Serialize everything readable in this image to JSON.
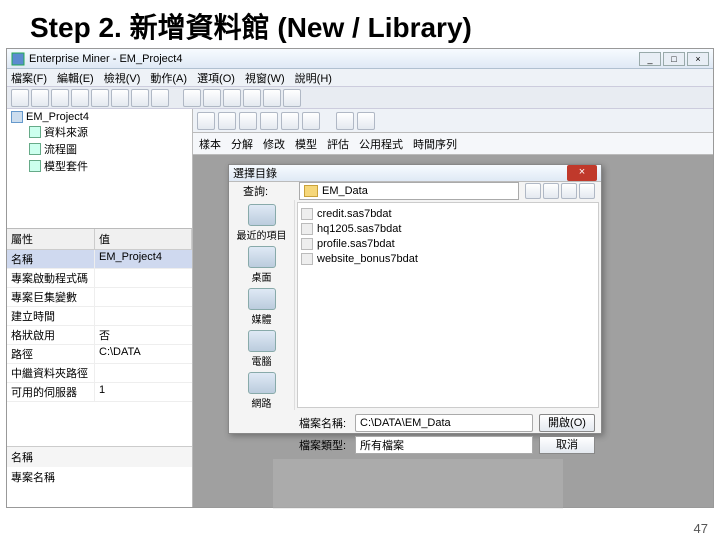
{
  "slide": {
    "title": "Step 2. 新增資料館 (New / Library)"
  },
  "titlebar": {
    "app_icon": "app-icon",
    "title": "Enterprise Miner - EM_Project4"
  },
  "window_buttons": {
    "min": "_",
    "max": "□",
    "close": "×"
  },
  "menubar": [
    "檔案(F)",
    "編輯(E)",
    "檢視(V)",
    "動作(A)",
    "選項(O)",
    "視窗(W)",
    "說明(H)"
  ],
  "toolbar_count": 14,
  "tree": {
    "root": "EM_Project4",
    "children": [
      "資料來源",
      "流程圖",
      "模型套件"
    ]
  },
  "props": {
    "hdr_name": "屬性",
    "hdr_value": "值",
    "rows": [
      {
        "k": "名稱",
        "v": "EM_Project4",
        "sel": true
      },
      {
        "k": "專案啟動程式碼",
        "v": ""
      },
      {
        "k": "專案巨集變數",
        "v": ""
      },
      {
        "k": "建立時間",
        "v": ""
      },
      {
        "k": "格狀啟用",
        "v": "否"
      },
      {
        "k": "路徑",
        "v": "C:\\DATA"
      },
      {
        "k": "中繼資料夾路徑",
        "v": ""
      },
      {
        "k": "可用的伺服器",
        "v": "1"
      }
    ]
  },
  "lower": {
    "hdr": "名稱",
    "desc": "專案名稱"
  },
  "canvas_tabs": [
    "樣本",
    "分解",
    "修改",
    "模型",
    "評估",
    "公用程式",
    "時間序列"
  ],
  "dialog": {
    "title": "選擇目錄",
    "close": "×",
    "loc_label": "查詢:",
    "loc_value": "EM_Data",
    "places": [
      "最近的項目",
      "桌面",
      "媒體",
      "電腦",
      "網路"
    ],
    "files": [
      "credit.sas7bdat",
      "hq1205.sas7bdat",
      "profile.sas7bdat",
      "website_bonus7bdat"
    ],
    "fname_label": "檔案名稱:",
    "fname_value": "C:\\DATA\\EM_Data",
    "ftype_label": "檔案類型:",
    "ftype_value": "所有檔案",
    "open_btn": "開啟(O)",
    "cancel_btn": "取消"
  },
  "page_number": "47"
}
